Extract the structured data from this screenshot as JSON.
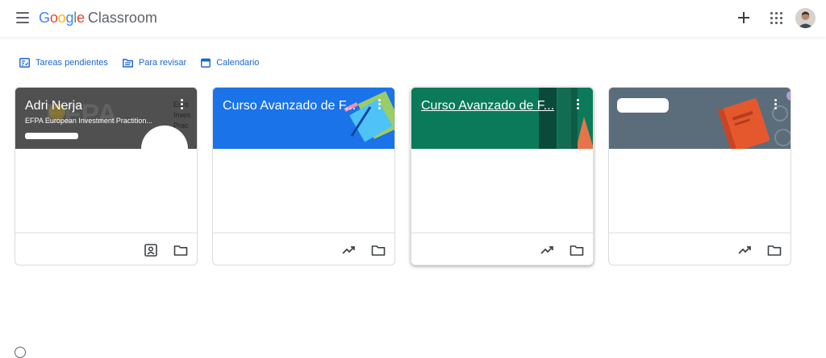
{
  "header": {
    "logo_google": [
      "G",
      "o",
      "o",
      "g",
      "l",
      "e"
    ],
    "logo_app": "Classroom",
    "icons": [
      "menu-icon",
      "plus-icon",
      "apps-grid-icon",
      "user-avatar"
    ]
  },
  "nav": {
    "items": [
      {
        "label": "Tareas pendientes",
        "icon": "assignment-icon"
      },
      {
        "label": "Para revisar",
        "icon": "review-list-icon"
      },
      {
        "label": "Calendario",
        "icon": "calendar-icon"
      }
    ]
  },
  "cards": [
    {
      "title": "Adri Nerja",
      "subtitle": "EFPA European Investment Practition...",
      "banner_color": "#5f6368",
      "footer_icons": [
        "assigned-work-icon",
        "folder-icon"
      ]
    },
    {
      "title": "Curso Avanzado de F...",
      "subtitle": "",
      "banner_color": "#1a73e8",
      "footer_icons": [
        "trending-icon",
        "folder-icon"
      ]
    },
    {
      "title": "Curso Avanzado de F...",
      "subtitle": "",
      "banner_color": "#0b7a5a",
      "footer_icons": [
        "trending-icon",
        "folder-icon"
      ]
    },
    {
      "title": "",
      "subtitle": "",
      "banner_color": "#5b6d7a",
      "footer_icons": [
        "trending-icon",
        "folder-icon"
      ]
    }
  ],
  "colors": {
    "accent": "#1967d2",
    "text": "#3c4043",
    "icon": "#5f6368"
  }
}
